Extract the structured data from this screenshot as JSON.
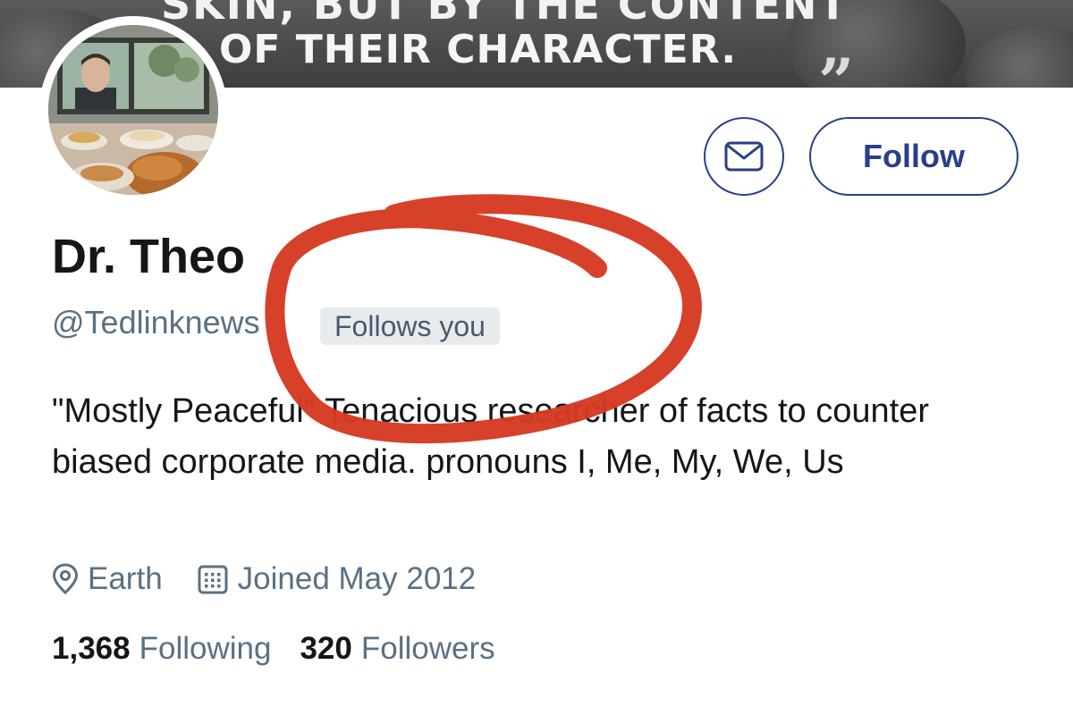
{
  "banner": {
    "line1": "SKIN, BUT BY THE CONTENT",
    "line2": "OF THEIR CHARACTER.",
    "quote_mark": "”"
  },
  "profile": {
    "name": "Dr. Theo",
    "handle": "@Tedlinknews",
    "follows_you_badge": "Follows you",
    "bio": "\"Mostly Peaceful\" Tenacious researcher of facts to counter biased corporate media. pronouns I, Me, My, We, Us",
    "location": "Earth",
    "joined": "Joined May 2012",
    "following_count": "1,368",
    "following_label": "Following",
    "followers_count": "320",
    "followers_label": "Followers"
  },
  "actions": {
    "follow_label": "Follow",
    "message_icon": "envelope-icon"
  },
  "icons": {
    "location": "location-pin-icon",
    "joined": "calendar-icon"
  },
  "colors": {
    "accent": "#2a3f86",
    "secondary_text": "#5b7083",
    "annotation": "#d63a22",
    "badge_bg": "#e7ebee"
  }
}
